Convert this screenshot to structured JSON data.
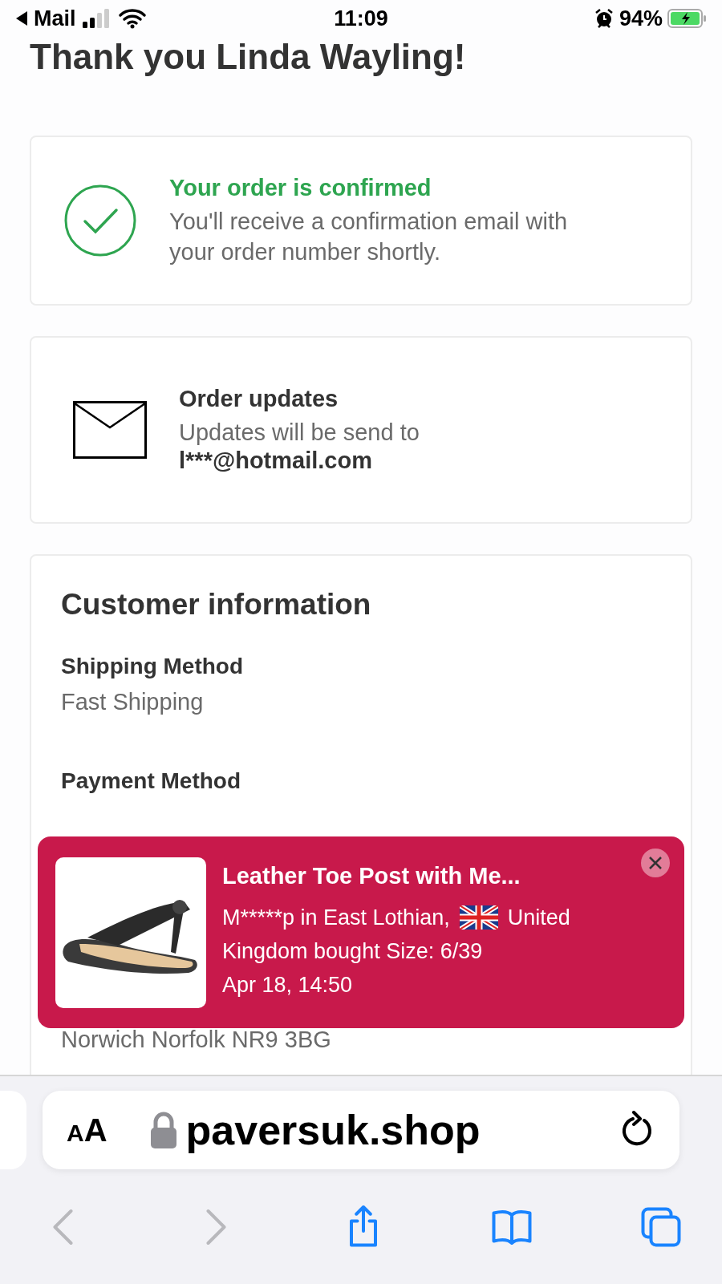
{
  "status_bar": {
    "back_app": "Mail",
    "time": "11:09",
    "battery": "94%"
  },
  "heading": "Thank you Linda Wayling!",
  "confirmation": {
    "title": "Your order is confirmed",
    "message": "You'll receive a confirmation email with your order number shortly."
  },
  "order_updates": {
    "title": "Order updates",
    "message": "Updates will be send to",
    "email": "l***@hotmail.com"
  },
  "customer_information": {
    "title": "Customer information",
    "items": [
      {
        "label": "Shipping Method",
        "value": "Fast Shipping"
      },
      {
        "label": "Payment Method"
      },
      {
        "value": "Norwich Norfolk NR9 3BG"
      }
    ]
  },
  "notification": {
    "title": "Leather Toe Post with Me...",
    "location": "M*****p in East Lothian,",
    "country_start": "United",
    "message": "Kingdom bought Size: 6/39",
    "time": "Apr 18, 14:50"
  },
  "browser": {
    "text_size": "AA",
    "url": "paversuk.shop",
    "nav": [
      {
        "kind": "back",
        "disabled": true
      },
      {
        "kind": "forward",
        "disabled": true
      },
      {
        "kind": "share",
        "disabled": false
      },
      {
        "kind": "bookmarks",
        "disabled": false
      },
      {
        "kind": "tabs",
        "disabled": false
      }
    ]
  }
}
